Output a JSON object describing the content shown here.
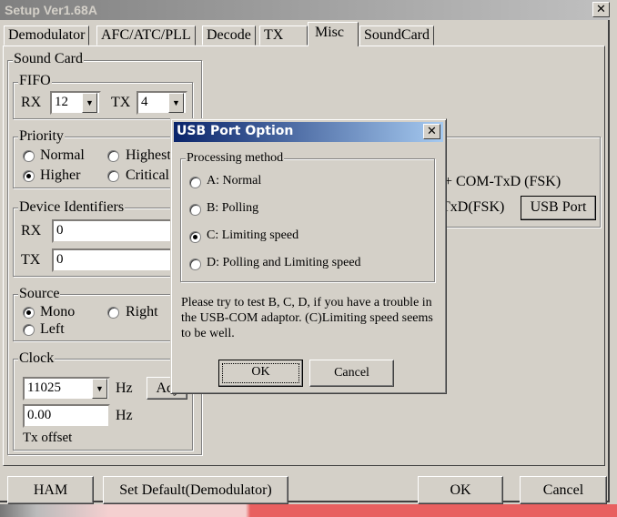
{
  "window": {
    "title": "Setup Ver1.68A",
    "close": "✕"
  },
  "tabs": [
    "Demodulator",
    "AFC/ATC/PLL",
    "Decode",
    "TX",
    "Misc",
    "SoundCard"
  ],
  "selected_tab": "Misc",
  "sound_card": {
    "label": "Sound Card",
    "fifo": {
      "label": "FIFO",
      "rx_label": "RX",
      "rx_value": "12",
      "tx_label": "TX",
      "tx_value": "4"
    },
    "priority": {
      "label": "Priority",
      "options": [
        "Normal",
        "Highest",
        "Higher",
        "Critical"
      ],
      "selected": "Higher"
    },
    "device": {
      "label": "Device Identifiers",
      "rx_label": "RX",
      "rx_value": "0",
      "tx_label": "TX",
      "tx_value": "0"
    },
    "source": {
      "label": "Source",
      "options": [
        "Mono",
        "Right",
        "Left"
      ],
      "selected": "Mono"
    },
    "clock": {
      "label": "Clock",
      "value": "11025",
      "unit": "Hz",
      "adj": "Adj",
      "offset_value": "0.00",
      "offset_unit": "Hz",
      "offset_label": "Tx offset"
    }
  },
  "tx_port": {
    "line1": "+ COM-TxD (FSK)",
    "line2": "TxD(FSK)",
    "usb_button": "USB Port"
  },
  "footer": {
    "ham": "HAM",
    "set_default": "Set Default(Demodulator)",
    "ok": "OK",
    "cancel": "Cancel"
  },
  "dialog": {
    "title": "USB Port Option",
    "close": "✕",
    "group": "Processing method",
    "options": [
      "A: Normal",
      "B: Polling",
      "C: Limiting speed",
      "D: Polling and Limiting speed"
    ],
    "selected": "C: Limiting speed",
    "note": "Please try to test B, C, D, if you have a trouble in the USB-COM adaptor. (C)Limiting speed seems to be well.",
    "ok": "OK",
    "cancel": "Cancel"
  },
  "colors": {
    "face": "#d4d0c8",
    "dialog_title_start": "#0a246a",
    "dialog_title_end": "#a6caf0"
  }
}
